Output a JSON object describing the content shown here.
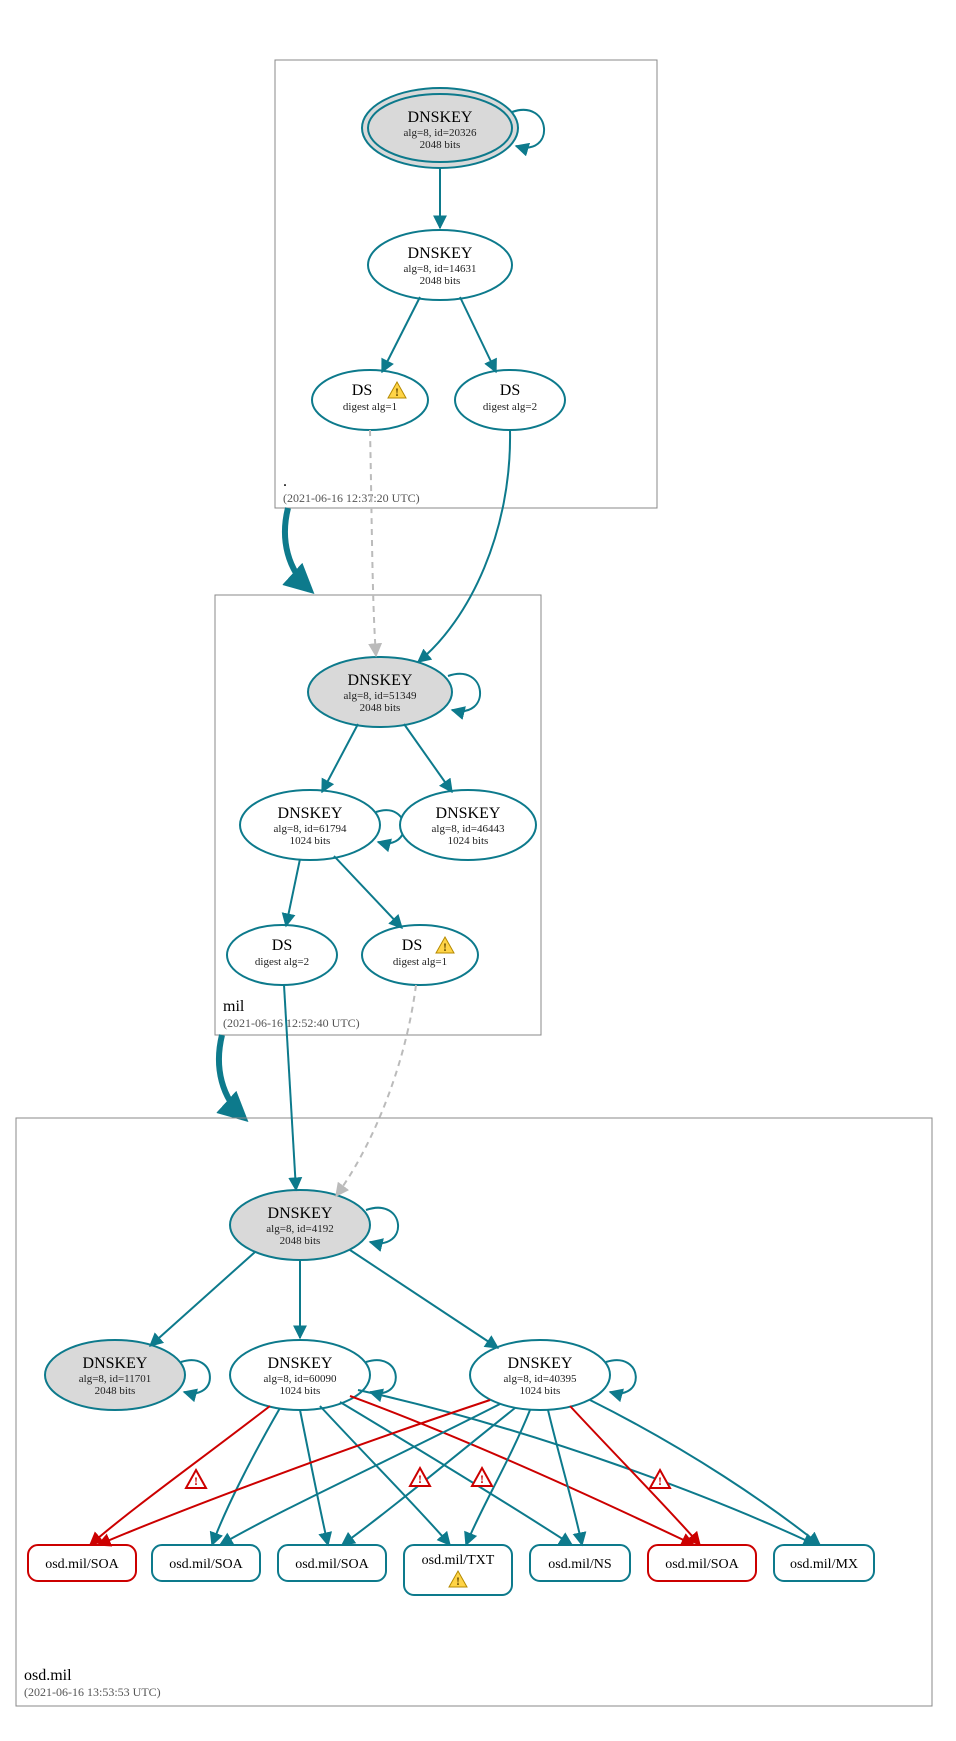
{
  "zones": {
    "root": {
      "label": ".",
      "timestamp": "(2021-06-16 12:37:20 UTC)"
    },
    "mil": {
      "label": "mil",
      "timestamp": "(2021-06-16 12:52:40 UTC)"
    },
    "osd": {
      "label": "osd.mil",
      "timestamp": "(2021-06-16 13:53:53 UTC)"
    }
  },
  "nodes": {
    "root_ksk": {
      "title": "DNSKEY",
      "sub1": "alg=8, id=20326",
      "sub2": "2048 bits"
    },
    "root_zsk": {
      "title": "DNSKEY",
      "sub1": "alg=8, id=14631",
      "sub2": "2048 bits"
    },
    "root_ds1": {
      "title": "DS",
      "sub1": "digest alg=1"
    },
    "root_ds2": {
      "title": "DS",
      "sub1": "digest alg=2"
    },
    "mil_ksk": {
      "title": "DNSKEY",
      "sub1": "alg=8, id=51349",
      "sub2": "2048 bits"
    },
    "mil_zsk1": {
      "title": "DNSKEY",
      "sub1": "alg=8, id=61794",
      "sub2": "1024 bits"
    },
    "mil_zsk2": {
      "title": "DNSKEY",
      "sub1": "alg=8, id=46443",
      "sub2": "1024 bits"
    },
    "mil_ds2": {
      "title": "DS",
      "sub1": "digest alg=2"
    },
    "mil_ds1": {
      "title": "DS",
      "sub1": "digest alg=1"
    },
    "osd_ksk": {
      "title": "DNSKEY",
      "sub1": "alg=8, id=4192",
      "sub2": "2048 bits"
    },
    "osd_ksk2": {
      "title": "DNSKEY",
      "sub1": "alg=8, id=11701",
      "sub2": "2048 bits"
    },
    "osd_zsk1": {
      "title": "DNSKEY",
      "sub1": "alg=8, id=60090",
      "sub2": "1024 bits"
    },
    "osd_zsk2": {
      "title": "DNSKEY",
      "sub1": "alg=8, id=40395",
      "sub2": "1024 bits"
    }
  },
  "rr": {
    "r1": "osd.mil/SOA",
    "r2": "osd.mil/SOA",
    "r3": "osd.mil/SOA",
    "r4": "osd.mil/TXT",
    "r5": "osd.mil/NS",
    "r6": "osd.mil/SOA",
    "r7": "osd.mil/MX"
  },
  "chart_data": {
    "type": "graph",
    "zones": [
      {
        "name": ".",
        "timestamp": "2021-06-16 12:37:20 UTC"
      },
      {
        "name": "mil",
        "timestamp": "2021-06-16 12:52:40 UTC"
      },
      {
        "name": "osd.mil",
        "timestamp": "2021-06-16 13:53:53 UTC"
      }
    ],
    "nodes": [
      {
        "id": "root_ksk",
        "zone": ".",
        "type": "DNSKEY",
        "alg": 8,
        "key_id": 20326,
        "bits": 2048,
        "ksk": true,
        "trust_anchor": true
      },
      {
        "id": "root_zsk",
        "zone": ".",
        "type": "DNSKEY",
        "alg": 8,
        "key_id": 14631,
        "bits": 2048
      },
      {
        "id": "root_ds1",
        "zone": ".",
        "type": "DS",
        "digest_alg": 1,
        "warning": true
      },
      {
        "id": "root_ds2",
        "zone": ".",
        "type": "DS",
        "digest_alg": 2
      },
      {
        "id": "mil_ksk",
        "zone": "mil",
        "type": "DNSKEY",
        "alg": 8,
        "key_id": 51349,
        "bits": 2048,
        "ksk": true
      },
      {
        "id": "mil_zsk1",
        "zone": "mil",
        "type": "DNSKEY",
        "alg": 8,
        "key_id": 61794,
        "bits": 1024
      },
      {
        "id": "mil_zsk2",
        "zone": "mil",
        "type": "DNSKEY",
        "alg": 8,
        "key_id": 46443,
        "bits": 1024
      },
      {
        "id": "mil_ds2",
        "zone": "mil",
        "type": "DS",
        "digest_alg": 2
      },
      {
        "id": "mil_ds1",
        "zone": "mil",
        "type": "DS",
        "digest_alg": 1,
        "warning": true
      },
      {
        "id": "osd_ksk",
        "zone": "osd.mil",
        "type": "DNSKEY",
        "alg": 8,
        "key_id": 4192,
        "bits": 2048,
        "ksk": true
      },
      {
        "id": "osd_ksk2",
        "zone": "osd.mil",
        "type": "DNSKEY",
        "alg": 8,
        "key_id": 11701,
        "bits": 2048,
        "ksk": true
      },
      {
        "id": "osd_zsk1",
        "zone": "osd.mil",
        "type": "DNSKEY",
        "alg": 8,
        "key_id": 60090,
        "bits": 1024
      },
      {
        "id": "osd_zsk2",
        "zone": "osd.mil",
        "type": "DNSKEY",
        "alg": 8,
        "key_id": 40395,
        "bits": 1024
      },
      {
        "id": "osd_soa_a",
        "zone": "osd.mil",
        "type": "RRset",
        "name": "osd.mil/SOA",
        "status": "error"
      },
      {
        "id": "osd_soa_b",
        "zone": "osd.mil",
        "type": "RRset",
        "name": "osd.mil/SOA"
      },
      {
        "id": "osd_soa_c",
        "zone": "osd.mil",
        "type": "RRset",
        "name": "osd.mil/SOA"
      },
      {
        "id": "osd_txt",
        "zone": "osd.mil",
        "type": "RRset",
        "name": "osd.mil/TXT",
        "warning": true
      },
      {
        "id": "osd_ns",
        "zone": "osd.mil",
        "type": "RRset",
        "name": "osd.mil/NS"
      },
      {
        "id": "osd_soa_d",
        "zone": "osd.mil",
        "type": "RRset",
        "name": "osd.mil/SOA",
        "status": "error"
      },
      {
        "id": "osd_mx",
        "zone": "osd.mil",
        "type": "RRset",
        "name": "osd.mil/MX"
      }
    ],
    "edges": [
      {
        "from": "root_ksk",
        "to": "root_ksk",
        "kind": "self"
      },
      {
        "from": "root_ksk",
        "to": "root_zsk"
      },
      {
        "from": "root_zsk",
        "to": "root_ds1"
      },
      {
        "from": "root_zsk",
        "to": "root_ds2"
      },
      {
        "from": "root_ds1",
        "to": "mil_ksk",
        "style": "dashed-grey"
      },
      {
        "from": "root_ds2",
        "to": "mil_ksk"
      },
      {
        "from": "mil_ksk",
        "to": "mil_ksk",
        "kind": "self"
      },
      {
        "from": "mil_ksk",
        "to": "mil_zsk1"
      },
      {
        "from": "mil_ksk",
        "to": "mil_zsk2"
      },
      {
        "from": "mil_zsk1",
        "to": "mil_zsk1",
        "kind": "self"
      },
      {
        "from": "mil_zsk1",
        "to": "mil_ds2"
      },
      {
        "from": "mil_zsk1",
        "to": "mil_ds1"
      },
      {
        "from": "mil_ds2",
        "to": "osd_ksk"
      },
      {
        "from": "mil_ds1",
        "to": "osd_ksk",
        "style": "dashed-grey"
      },
      {
        "from": "osd_ksk",
        "to": "osd_ksk",
        "kind": "self"
      },
      {
        "from": "osd_ksk",
        "to": "osd_ksk2"
      },
      {
        "from": "osd_ksk",
        "to": "osd_zsk1"
      },
      {
        "from": "osd_ksk",
        "to": "osd_zsk2"
      },
      {
        "from": "osd_ksk2",
        "to": "osd_ksk2",
        "kind": "self"
      },
      {
        "from": "osd_zsk1",
        "to": "osd_zsk1",
        "kind": "self"
      },
      {
        "from": "osd_zsk2",
        "to": "osd_zsk2",
        "kind": "self"
      },
      {
        "from": "osd_zsk1",
        "to": "osd_soa_a",
        "status": "error"
      },
      {
        "from": "osd_zsk1",
        "to": "osd_soa_b"
      },
      {
        "from": "osd_zsk1",
        "to": "osd_soa_c"
      },
      {
        "from": "osd_zsk1",
        "to": "osd_txt"
      },
      {
        "from": "osd_zsk1",
        "to": "osd_ns"
      },
      {
        "from": "osd_zsk1",
        "to": "osd_soa_d",
        "status": "error"
      },
      {
        "from": "osd_zsk1",
        "to": "osd_mx"
      },
      {
        "from": "osd_zsk2",
        "to": "osd_soa_a",
        "status": "error"
      },
      {
        "from": "osd_zsk2",
        "to": "osd_soa_b"
      },
      {
        "from": "osd_zsk2",
        "to": "osd_soa_c"
      },
      {
        "from": "osd_zsk2",
        "to": "osd_txt"
      },
      {
        "from": "osd_zsk2",
        "to": "osd_ns"
      },
      {
        "from": "osd_zsk2",
        "to": "osd_soa_d",
        "status": "error"
      },
      {
        "from": "osd_zsk2",
        "to": "osd_mx"
      }
    ],
    "delegations": [
      {
        "from": ".",
        "to": "mil"
      },
      {
        "from": "mil",
        "to": "osd.mil"
      }
    ]
  }
}
